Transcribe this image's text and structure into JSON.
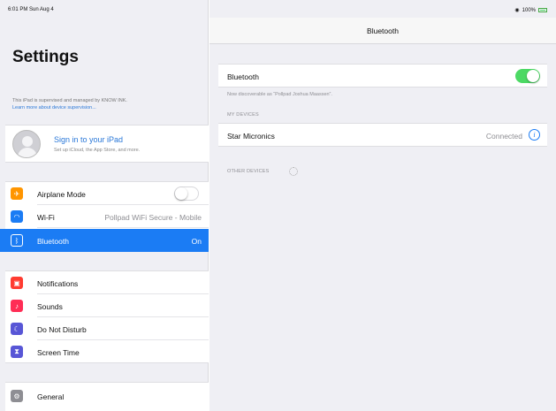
{
  "status_bar": {
    "time": "6:01 PM  Sun Aug 4",
    "battery": "100%"
  },
  "sidebar": {
    "title": "Settings",
    "supervision_text": "This iPad is supervised and managed by KNOW INK.",
    "supervision_link": "Learn more about device supervision...",
    "account": {
      "title": "Sign in to your iPad",
      "subtitle": "Set up iCloud, the App Store, and more."
    },
    "connectivity": [
      {
        "label": "Airplane Mode",
        "value": "",
        "icon": "airplane-icon",
        "color": "#ff9500"
      },
      {
        "label": "Wi-Fi",
        "value": "Pollpad WiFi Secure - Mobile",
        "icon": "wifi-icon",
        "color": "#1b7cf4"
      },
      {
        "label": "Bluetooth",
        "value": "On",
        "icon": "bluetooth-icon",
        "color": "#1b7cf4"
      }
    ],
    "general_group": [
      {
        "label": "Notifications",
        "icon": "notifications-icon",
        "color": "#ff3b30"
      },
      {
        "label": "Sounds",
        "icon": "sounds-icon",
        "color": "#ff2d55"
      },
      {
        "label": "Do Not Disturb",
        "icon": "moon-icon",
        "color": "#5856d6"
      },
      {
        "label": "Screen Time",
        "icon": "hourglass-icon",
        "color": "#5856d6"
      }
    ],
    "general": {
      "label": "General",
      "icon": "gear-icon",
      "color": "#8e8e93"
    }
  },
  "detail": {
    "title": "Bluetooth",
    "bluetooth_label": "Bluetooth",
    "bluetooth_on": true,
    "discoverable_note": "Now discoverable as “Pollpad Joshua Maassen”.",
    "my_devices_header": "MY DEVICES",
    "devices": [
      {
        "name": "Star Micronics",
        "status": "Connected"
      }
    ],
    "other_devices_header": "OTHER DEVICES"
  },
  "colors": {
    "accent": "#1b7cf4",
    "toggle_on": "#4cd964",
    "background": "#efeff4"
  }
}
